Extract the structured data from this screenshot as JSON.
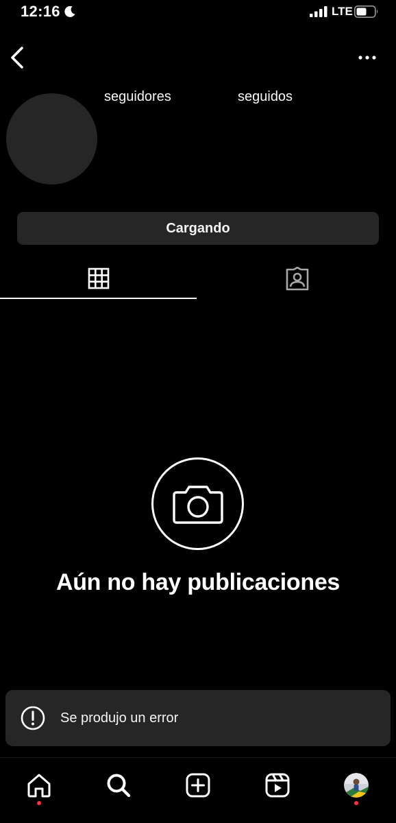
{
  "status_bar": {
    "time": "12:16",
    "network": "LTE",
    "icons": [
      "moon-icon",
      "signal-icon",
      "battery-icon"
    ]
  },
  "nav": {
    "back_icon": "chevron-left-icon",
    "more_icon": "more-horizontal-icon"
  },
  "profile": {
    "followers_label": "seguidores",
    "following_label": "seguidos",
    "action_button_label": "Cargando"
  },
  "tabs": [
    {
      "icon": "grid-icon",
      "selected": true
    },
    {
      "icon": "tagged-person-icon",
      "selected": false
    }
  ],
  "empty_state": {
    "icon": "camera-icon",
    "title": "Aún no hay publicaciones"
  },
  "toast": {
    "icon": "alert-circle-icon",
    "message": "Se produjo un error"
  },
  "bottom_nav": {
    "items": [
      "home-icon",
      "search-icon",
      "create-icon",
      "reels-icon",
      "profile-avatar"
    ],
    "notification_dot_color": "#ff3040"
  },
  "colors": {
    "background": "#000000",
    "surface": "#262626",
    "text": "#f5f5f5"
  }
}
